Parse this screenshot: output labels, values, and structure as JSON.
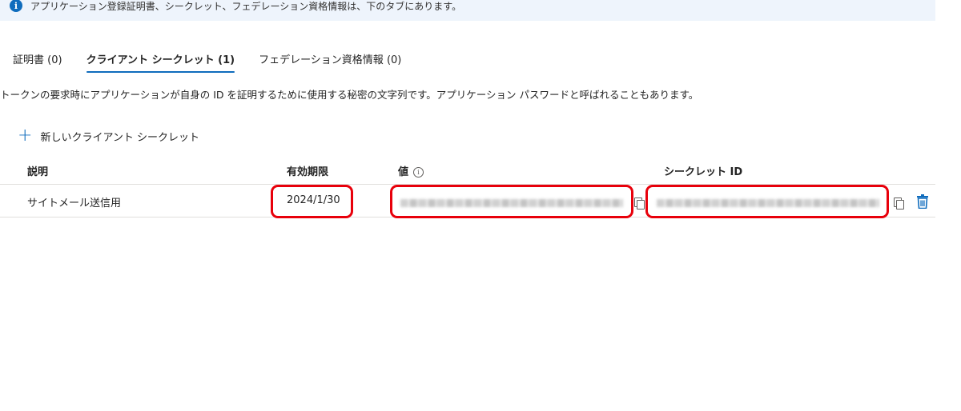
{
  "banner": {
    "icon": "info-icon",
    "text": "アプリケーション登録証明書、シークレット、フェデレーション資格情報は、下のタブにあります。"
  },
  "tabs": [
    {
      "label": "証明書",
      "count": "(0)",
      "active": false
    },
    {
      "label": "クライアント シークレット",
      "count": "(1)",
      "active": true
    },
    {
      "label": "フェデレーション資格情報",
      "count": "(0)",
      "active": false
    }
  ],
  "description": "トークンの要求時にアプリケーションが自身の ID を証明するために使用する秘密の文字列です。アプリケーション パスワードと呼ばれることもあります。",
  "new_secret_button": {
    "icon": "plus-icon",
    "label": "新しいクライアント シークレット"
  },
  "table": {
    "headers": {
      "description": "説明",
      "expires": "有効期限",
      "value": "値",
      "secret_id": "シークレット ID"
    },
    "rows": [
      {
        "description": "サイトメール送信用",
        "expires": "2024/1/30"
      }
    ]
  },
  "colors": {
    "accent": "#0f6cbd",
    "highlight": "#e8000b",
    "banner_bg": "#eef4fc"
  }
}
